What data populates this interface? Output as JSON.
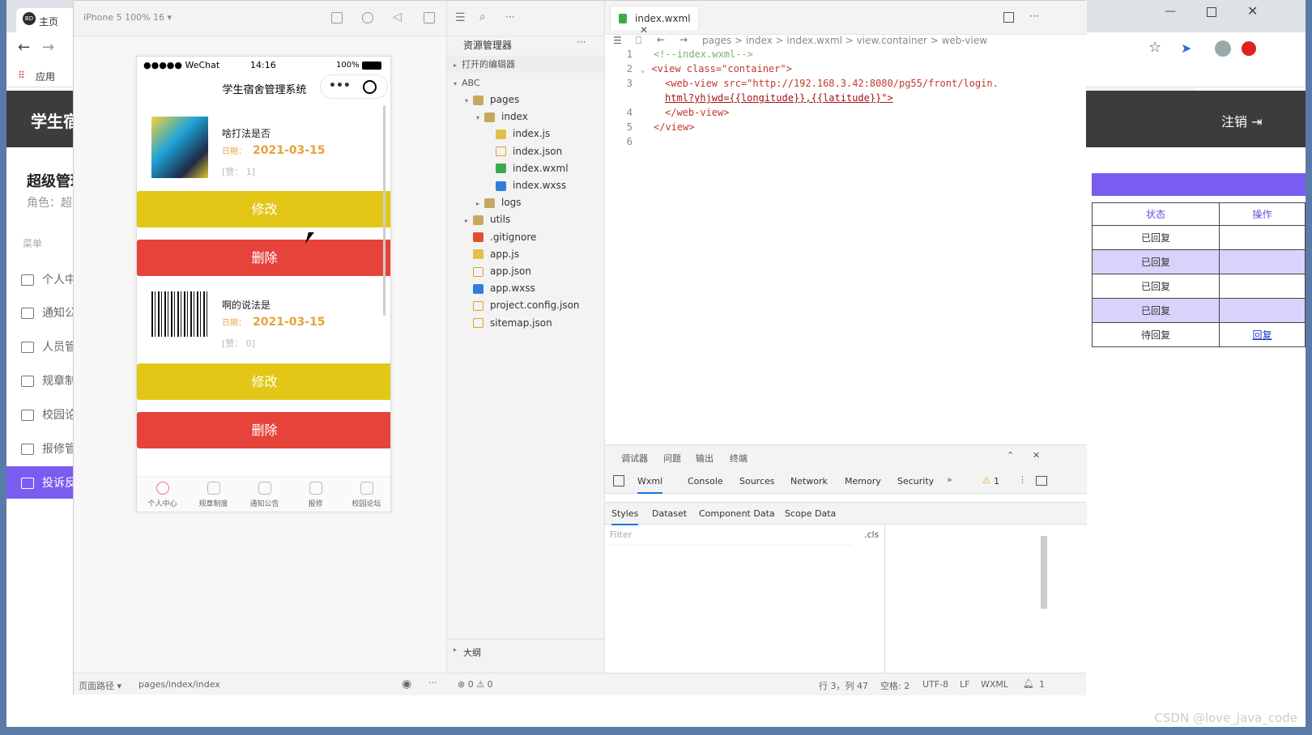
{
  "browser": {
    "tab_title": "主页",
    "tab_logo": "BD",
    "bookmark_apps": "应用",
    "web_app": {
      "header_title": "学生宿",
      "logout": "注销",
      "sidebar_title": "超级管理",
      "role": "角色：超",
      "menu_head": "菜单",
      "menu": [
        "个人中",
        "通知公",
        "人员管",
        "规章制",
        "校园论",
        "报修管",
        "投诉反"
      ],
      "table": {
        "headers": [
          "状态",
          "操作"
        ],
        "rows": [
          {
            "status": "已回复",
            "action": ""
          },
          {
            "status": "已回复",
            "action": ""
          },
          {
            "status": "已回复",
            "action": ""
          },
          {
            "status": "已回复",
            "action": ""
          },
          {
            "status": "待回复",
            "action": "回复"
          }
        ]
      }
    }
  },
  "ide": {
    "device": "iPhone 5 100% 16 ▾",
    "phone": {
      "status_left": "●●●●● WeChat",
      "time": "14:16",
      "battery": "100%",
      "nav_title": "学生宿舍管理系统",
      "cards": [
        {
          "title": "啥打法是否",
          "date_label": "日期：",
          "date": "2021-03-15",
          "likes": "[赞：  1]"
        },
        {
          "title": "啊的说法是",
          "date_label": "日期：",
          "date": "2021-03-15",
          "likes": "[赞：  0]"
        }
      ],
      "edit_label": "修改",
      "delete_label": "删除",
      "tabbar": [
        "个人中心",
        "规章制度",
        "通知公告",
        "报修",
        "校园论坛"
      ]
    },
    "sim_footer": {
      "path_label": "页面路径 ▾",
      "path": "pages/index/index"
    },
    "explorer": {
      "title": "资源管理器",
      "open_editors": "打开的编辑器",
      "root": "ABC",
      "tree": [
        {
          "name": "pages",
          "depth": 1,
          "type": "folder",
          "open": true
        },
        {
          "name": "index",
          "depth": 2,
          "type": "folder",
          "open": true
        },
        {
          "name": "index.js",
          "depth": 3,
          "type": "js"
        },
        {
          "name": "index.json",
          "depth": 3,
          "type": "json"
        },
        {
          "name": "index.wxml",
          "depth": 3,
          "type": "wxml"
        },
        {
          "name": "index.wxss",
          "depth": 3,
          "type": "wxss"
        },
        {
          "name": "logs",
          "depth": 2,
          "type": "folder",
          "open": false
        },
        {
          "name": "utils",
          "depth": 1,
          "type": "folder",
          "open": false
        },
        {
          "name": ".gitignore",
          "depth": 1,
          "type": "git"
        },
        {
          "name": "app.js",
          "depth": 1,
          "type": "js"
        },
        {
          "name": "app.json",
          "depth": 1,
          "type": "json"
        },
        {
          "name": "app.wxss",
          "depth": 1,
          "type": "wxss"
        },
        {
          "name": "project.config.json",
          "depth": 1,
          "type": "json"
        },
        {
          "name": "sitemap.json",
          "depth": 1,
          "type": "json"
        }
      ],
      "outline": "大纲"
    },
    "editor": {
      "tab": "index.wxml",
      "breadcrumb": "pages  >  index  >  index.wxml  >  view.container  >  web-view",
      "lines": [
        {
          "n": "1",
          "text": "<!--index.wxml-->"
        },
        {
          "n": "2",
          "text": "<view class=\"container\">"
        },
        {
          "n": "3",
          "text": "<web-view src=\"http://192.168.3.42:8080/pg55/front/login."
        },
        {
          "n": "",
          "text": "html?yhjwd={{longitude}},{{latitude}}\">"
        },
        {
          "n": "4",
          "text": "</web-view>"
        },
        {
          "n": "5",
          "text": "</view>"
        },
        {
          "n": "6",
          "text": ""
        }
      ]
    },
    "debugger": {
      "tabs": [
        "调试器",
        "问题",
        "输出",
        "终端"
      ],
      "dev_tabs": [
        "Wxml",
        "Console",
        "Sources",
        "Network",
        "Memory",
        "Security"
      ],
      "warning_count": "1",
      "sub_tabs": [
        "Styles",
        "Dataset",
        "Component Data",
        "Scope Data"
      ],
      "filter_placeholder": "Filter",
      "cls": ".cls"
    },
    "status": {
      "errors": "⊗ 0 ⚠ 0",
      "position": "行 3，列 47",
      "spaces": "空格: 2",
      "encoding": "UTF-8",
      "eol": "LF",
      "lang": "WXML",
      "bell": "1"
    }
  },
  "watermark": "CSDN @love_java_code"
}
